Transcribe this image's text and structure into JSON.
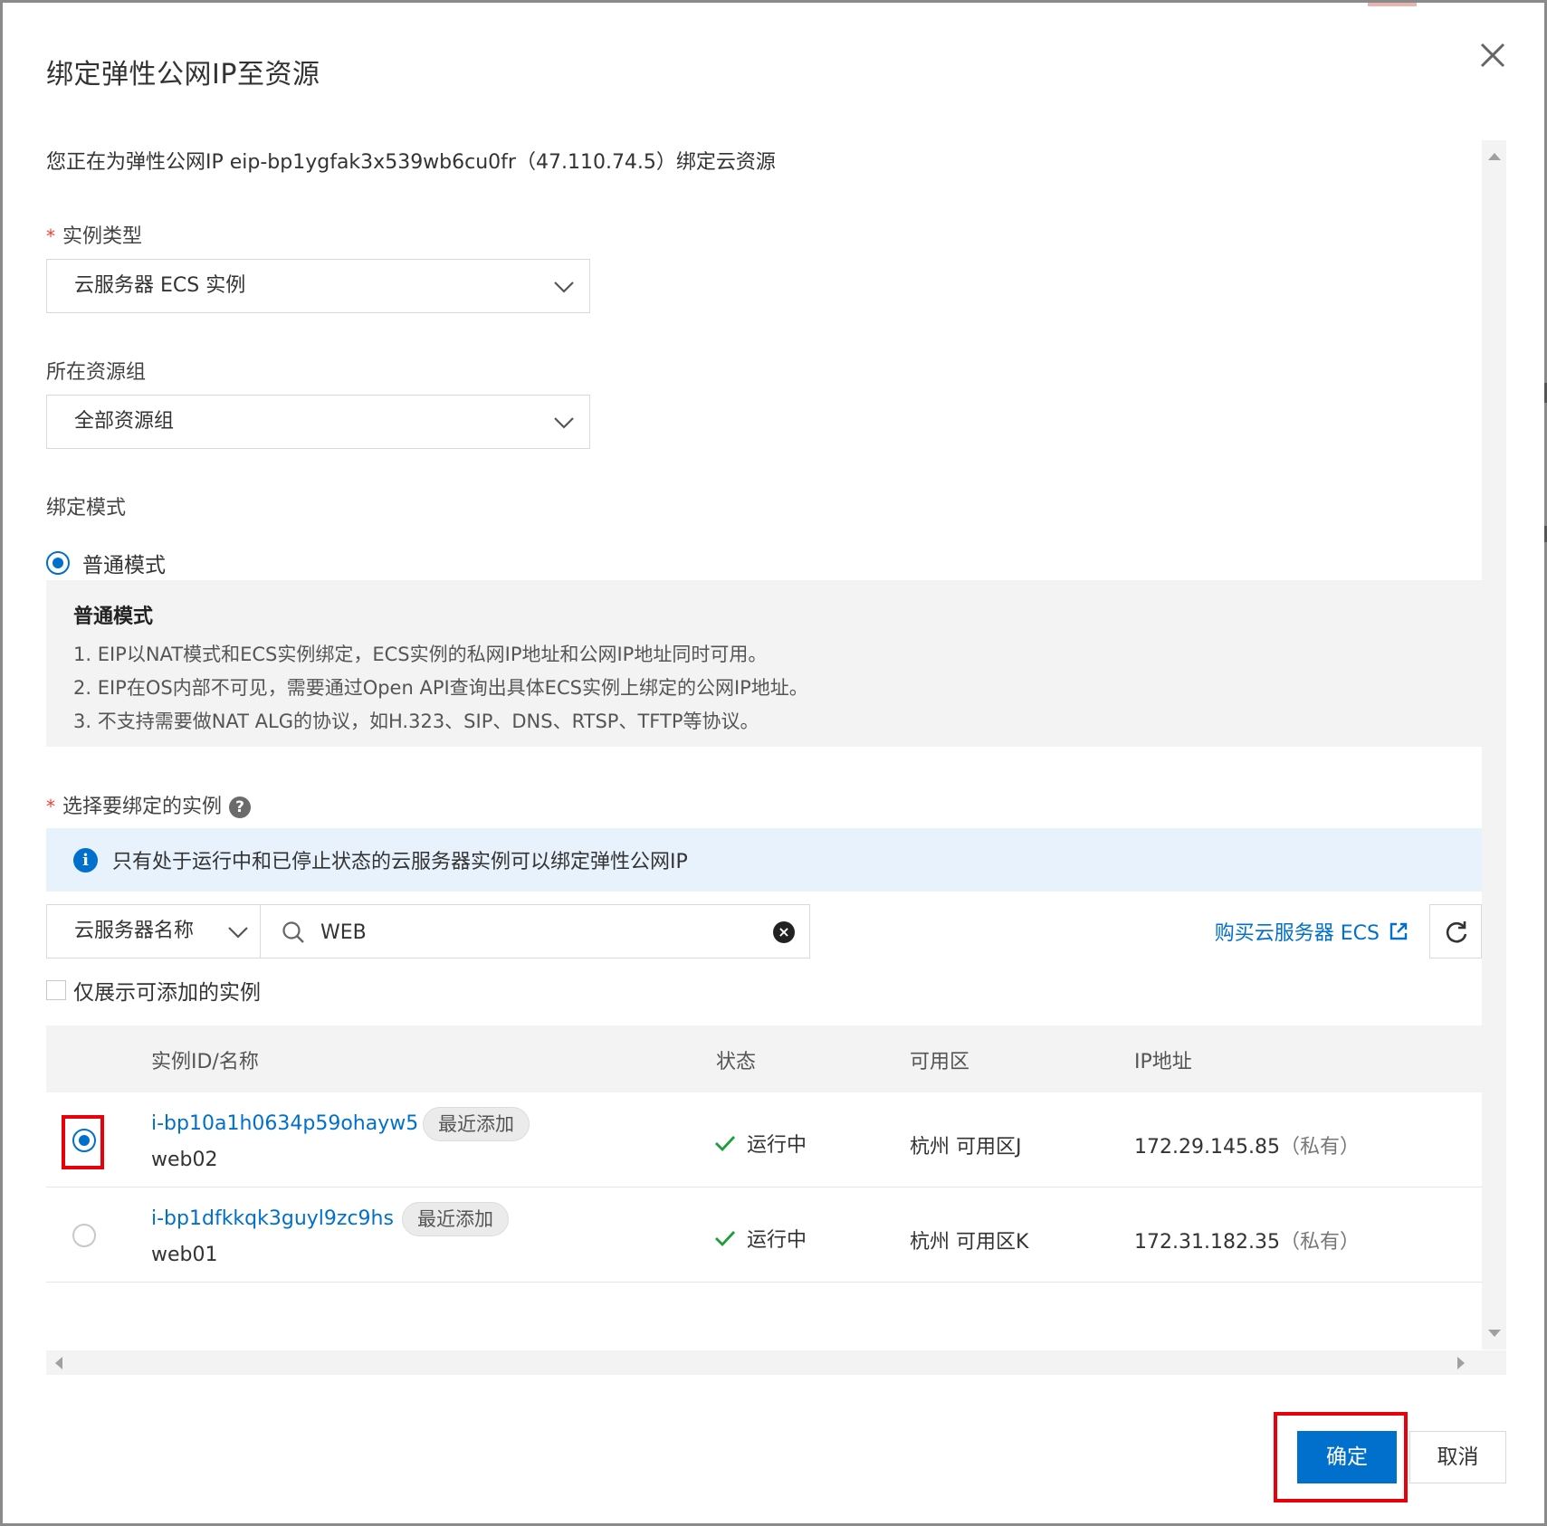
{
  "dialog": {
    "title": "绑定弹性公网IP至资源",
    "intro": "您正在为弹性公网IP eip-bp1ygfak3x539wb6cu0fr（47.110.74.5）绑定云资源"
  },
  "instance_type": {
    "required_mark": "*",
    "label": "实例类型",
    "value": "云服务器 ECS 实例"
  },
  "resource_group": {
    "label": "所在资源组",
    "value": "全部资源组"
  },
  "bind_mode": {
    "label": "绑定模式",
    "option": "普通模式",
    "desc_title": "普通模式",
    "desc_lines": [
      "1. EIP以NAT模式和ECS实例绑定，ECS实例的私网IP地址和公网IP地址同时可用。",
      "2. EIP在OS内部不可见，需要通过Open API查询出具体ECS实例上绑定的公网IP地址。",
      "3. 不支持需要做NAT ALG的协议，如H.323、SIP、DNS、RTSP、TFTP等协议。"
    ]
  },
  "select_instance": {
    "required_mark": "*",
    "label": "选择要绑定的实例",
    "help": "?",
    "info_icon": "i",
    "info": "只有处于运行中和已停止状态的云服务器实例可以绑定弹性公网IP",
    "filter_field": "云服务器名称",
    "search_value": "WEB",
    "clear_icon": "×",
    "buy_link": "购买云服务器 ECS",
    "only_addable": "仅展示可添加的实例"
  },
  "table": {
    "headers": [
      "实例ID/名称",
      "状态",
      "可用区",
      "IP地址"
    ],
    "rows": [
      {
        "id": "i-bp10a1h0634p59ohayw5",
        "tag": "最近添加",
        "name": "web02",
        "status": "运行中",
        "zone": "杭州 可用区J",
        "ip": "172.29.145.85",
        "ip_type": "（私有）",
        "selected": true
      },
      {
        "id": "i-bp1dfkkqk3guyl9zc9hs",
        "tag": "最近添加",
        "name": "web01",
        "status": "运行中",
        "zone": "杭州 可用区K",
        "ip": "172.31.182.35",
        "ip_type": "（私有）",
        "selected": false
      }
    ]
  },
  "footer": {
    "ok": "确定",
    "cancel": "取消"
  },
  "colors": {
    "primary": "#0070cc",
    "highlight": "#e8000b",
    "success": "#1e9e3a"
  }
}
